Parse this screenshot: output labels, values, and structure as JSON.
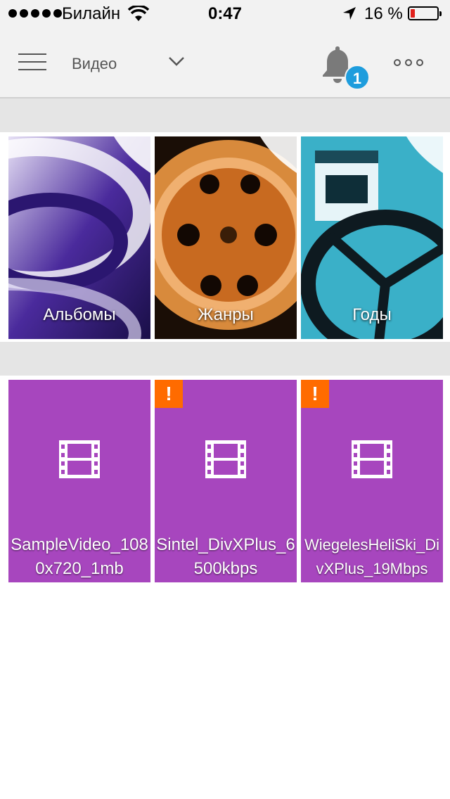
{
  "status_bar": {
    "carrier": "Билайн",
    "time": "0:47",
    "battery_percent": "16 %",
    "battery_level": 0.16,
    "signal_dots": 5
  },
  "header": {
    "title": "Видео",
    "notifications_count": "1"
  },
  "categories": [
    {
      "label": "Альбомы"
    },
    {
      "label": "Жанры"
    },
    {
      "label": "Годы"
    }
  ],
  "videos": [
    {
      "title": "SampleVideo_1080x720_1mb",
      "warning": false
    },
    {
      "title": "Sintel_DivXPlus_6500kbps",
      "warning": true,
      "warning_symbol": "!"
    },
    {
      "title": "WiegelesHeliSki_DivXPlus_19Mbps",
      "warning": true,
      "warning_symbol": "!"
    }
  ],
  "colors": {
    "video_tile": "#a746be",
    "warning": "#ff6b00",
    "badge": "#1e9ddd",
    "battery_low": "#e0201b"
  }
}
